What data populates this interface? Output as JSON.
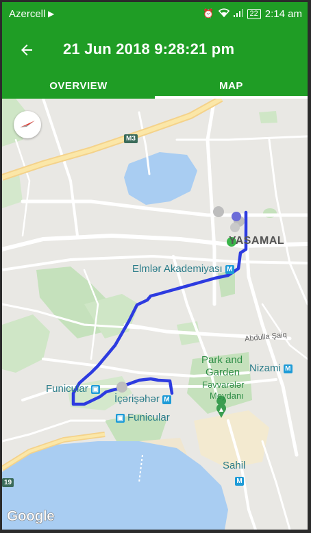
{
  "status_bar": {
    "carrier": "Azercell",
    "battery": "22",
    "time": "2:14 am"
  },
  "app_bar": {
    "title": "21 Jun 2018 9:28:21 pm"
  },
  "tabs": [
    {
      "label": "OVERVIEW",
      "selected": false
    },
    {
      "label": "MAP",
      "selected": true
    }
  ],
  "map": {
    "labels": {
      "highway_m3": "M3",
      "highway_19": "19",
      "yasamal": "YASAMAL",
      "elmler": "Elmlər Akademiyası",
      "abdulla": "Abdulla Şaiq",
      "park_line1": "Park and",
      "park_line2": "Garden",
      "fevvareler_line1": "Fəvvarələr",
      "fevvareler_line2": "Meydanı",
      "nizami": "Nizami",
      "funicular_left": "Funicular",
      "icerisheher": "İçərişəhər",
      "funicular_bottom": "Funicular",
      "sahil": "Sahil",
      "google": "Google"
    },
    "route_color": "#2d3be0",
    "accent_green": "#1f9d25"
  }
}
